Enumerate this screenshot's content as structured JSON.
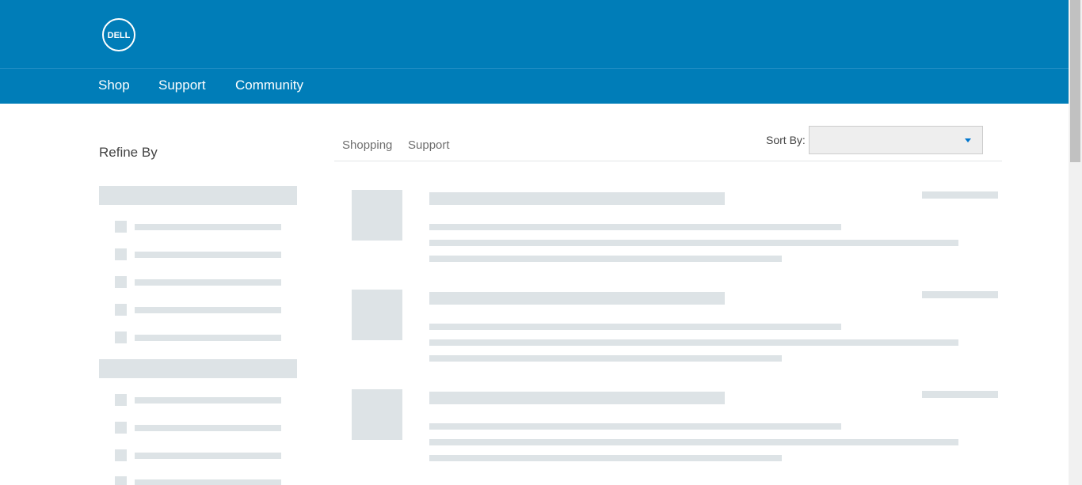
{
  "header": {
    "logo_text": "DELL",
    "nav": [
      {
        "label": "Shop"
      },
      {
        "label": "Support"
      },
      {
        "label": "Community"
      }
    ]
  },
  "sidebar": {
    "title": "Refine By"
  },
  "main": {
    "tabs": [
      {
        "label": "Shopping"
      },
      {
        "label": "Support"
      }
    ],
    "sort": {
      "label": "Sort By:",
      "value": ""
    }
  },
  "colors": {
    "brand": "#007db8",
    "skeleton": "#dde3e6",
    "dropdown_arrow": "#0076ce"
  }
}
